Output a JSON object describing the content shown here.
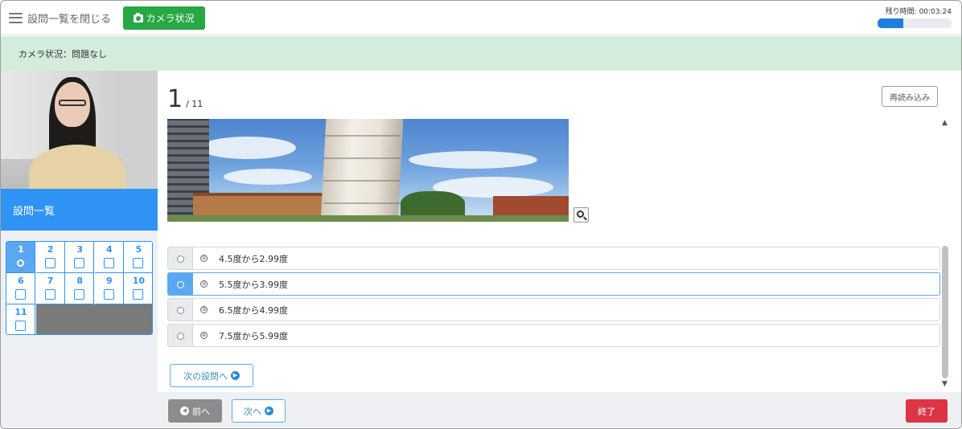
{
  "header": {
    "close_list_label": "設問一覧を閉じる",
    "camera_button_label": "カメラ状況",
    "timer_label": "残り時間: 00:03:24",
    "time_progress": 0.35
  },
  "status": {
    "text": "カメラ状況：問題なし"
  },
  "sidebar": {
    "question_list_label": "設問一覧",
    "questions": [
      "1",
      "2",
      "3",
      "4",
      "5",
      "6",
      "7",
      "8",
      "9",
      "10",
      "11"
    ],
    "current_question": "1"
  },
  "main": {
    "current": "1",
    "total": "/ 11",
    "reload_label": "再読み込み",
    "options": [
      {
        "marker": "①",
        "text": "4.5度から2.99度",
        "selected": false
      },
      {
        "marker": "②",
        "text": "5.5度から3.99度",
        "selected": true
      },
      {
        "marker": "③",
        "text": "6.5度から4.99度",
        "selected": false
      },
      {
        "marker": "④",
        "text": "7.5度から5.99度",
        "selected": false
      }
    ],
    "next_question_label": "次の設問へ"
  },
  "footer": {
    "prev_label": "前へ",
    "next_label": "次へ",
    "end_label": "終了"
  },
  "colors": {
    "accent": "#2f93f5",
    "success": "#28a745",
    "danger": "#dc3545",
    "status_bg": "#d4ecdc"
  }
}
